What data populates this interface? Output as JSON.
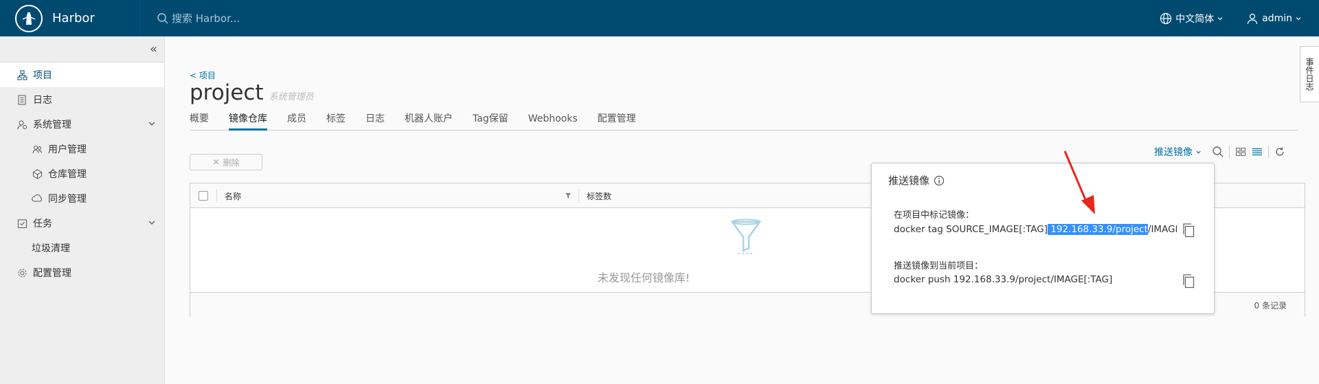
{
  "header": {
    "brand": "Harbor",
    "search_placeholder": "搜索 Harbor...",
    "language": "中文简体",
    "user": "admin"
  },
  "sidebar": {
    "items": [
      {
        "label": "项目",
        "icon": "project-icon",
        "active": true
      },
      {
        "label": "日志",
        "icon": "log-icon"
      },
      {
        "label": "系统管理",
        "icon": "admin-icon",
        "expandable": true
      },
      {
        "label": "用户管理",
        "icon": "users-icon",
        "sub": true
      },
      {
        "label": "仓库管理",
        "icon": "registry-icon",
        "sub": true
      },
      {
        "label": "同步管理",
        "icon": "replication-icon",
        "sub": true
      },
      {
        "label": "任务",
        "icon": "task-icon",
        "expandable": true
      },
      {
        "label": "垃圾清理",
        "sub": true
      },
      {
        "label": "配置管理",
        "icon": "gear-icon"
      }
    ]
  },
  "main": {
    "breadcrumb": "< 项目",
    "title": "project",
    "role": "系统管理员",
    "tabs": [
      "概要",
      "镜像仓库",
      "成员",
      "标签",
      "日志",
      "机器人账户",
      "Tag保留",
      "Webhooks",
      "配置管理"
    ],
    "active_tab": "镜像仓库",
    "delete_button": "删除",
    "push_button": "推送镜像",
    "columns": [
      "名称",
      "标签数"
    ],
    "empty_message": "未发现任何镜像库!",
    "record_count": "0 条记录"
  },
  "popover": {
    "title": "推送镜像",
    "tag_label": "在项目中标记镜像：",
    "tag_cmd_prefix": "docker tag SOURCE_IMAGE[:TAG]",
    "tag_cmd_highlight": " 192.168.33.9/project",
    "tag_cmd_suffix": "/IMAGE[:TAG]",
    "push_label": "推送镜像到当前项目：",
    "push_cmd": "docker push 192.168.33.9/project/IMAGE[:TAG]"
  },
  "side_tab": "事件日志",
  "colors": {
    "header_bg": "#004a70",
    "accent": "#0072a3",
    "highlight": "#3390ff",
    "arrow": "#e8261a"
  }
}
